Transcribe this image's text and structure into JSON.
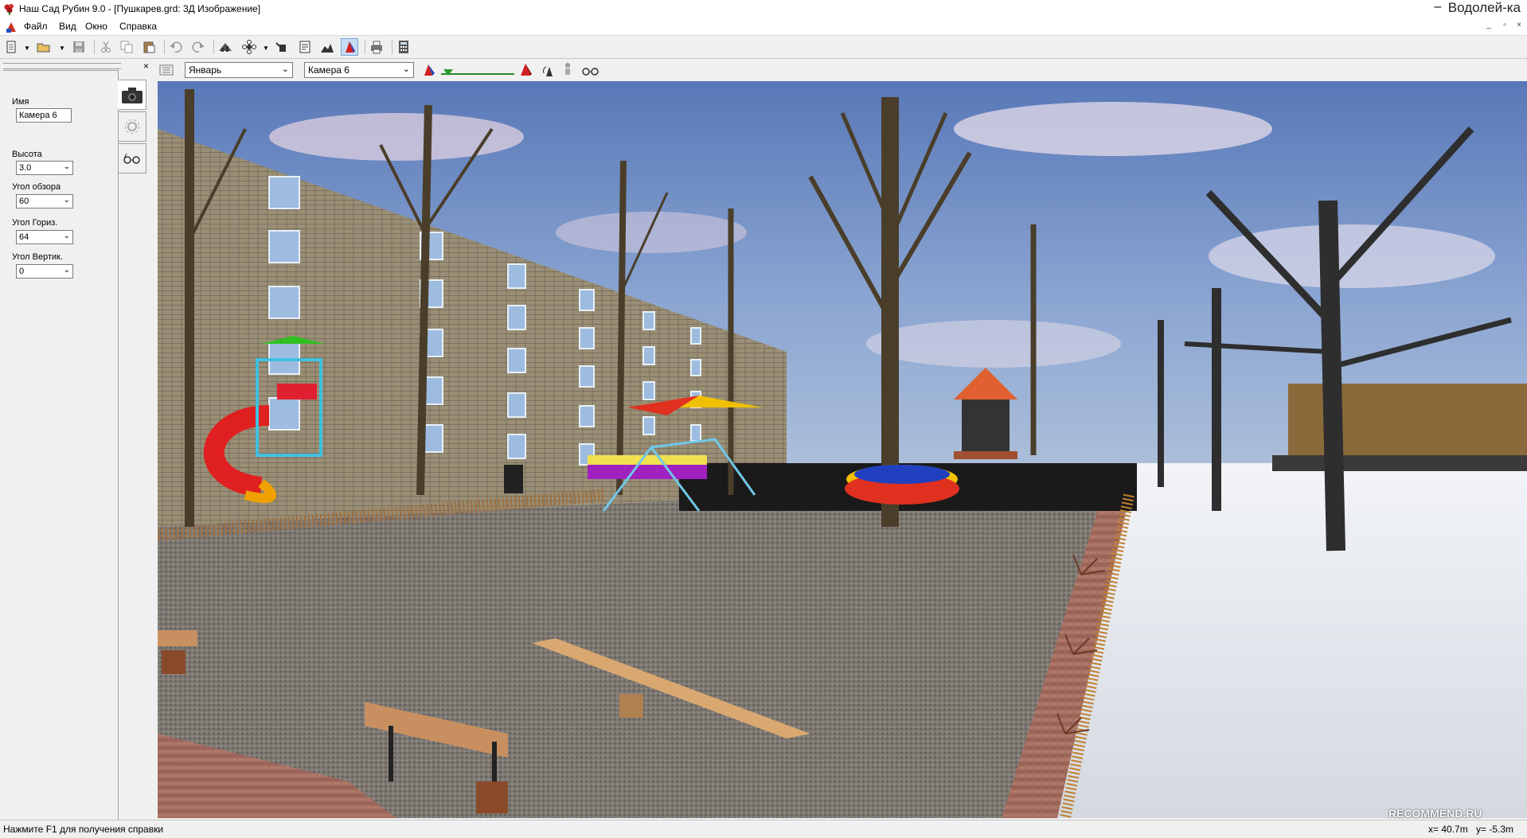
{
  "window": {
    "title": "Наш Сад Рубин 9.0 - [Пушкарев.grd: 3Д Изображение]",
    "user": "Водолей-ка",
    "minimize": "–"
  },
  "menu": {
    "items": [
      "Файл",
      "Вид",
      "Окно",
      "Справка"
    ],
    "mdi_controls": [
      "_",
      "▫",
      "×"
    ]
  },
  "toolbar": {
    "icons": [
      "new-document-icon",
      "open-folder-icon",
      "save-icon",
      "cut-icon",
      "copy-icon",
      "paste-icon",
      "undo-icon",
      "redo-icon",
      "garden-plan-icon",
      "flower-library-icon",
      "watering-can-icon",
      "notes-icon",
      "terrain-icon",
      "3d-view-icon",
      "print-icon",
      "calculator-icon"
    ]
  },
  "left_panel": {
    "close": "×",
    "name_label": "Имя",
    "name_value": "Камера 6",
    "height_label": "Высота",
    "height_value": "3.0",
    "fov_label": "Угол обзора",
    "fov_value": "60",
    "horiz_label": "Угол Гориз.",
    "horiz_value": "64",
    "vert_label": "Угол Вертик.",
    "vert_value": "0",
    "tabs": [
      "camera-icon",
      "sun-settings-icon",
      "glasses-icon"
    ]
  },
  "viewbar": {
    "month": "Январь",
    "camera": "Камера 6"
  },
  "statusbar": {
    "help": "Нажмите F1 для получения справки",
    "x": "x=  40.7m",
    "y": "y=  -5.3m"
  },
  "watermark": "RECOMMEND.RU",
  "colors": {
    "active_tab": "#c6dbf5",
    "sky": "#6f93c4",
    "ground": "#8a8580",
    "snow": "#e8ebf0"
  }
}
